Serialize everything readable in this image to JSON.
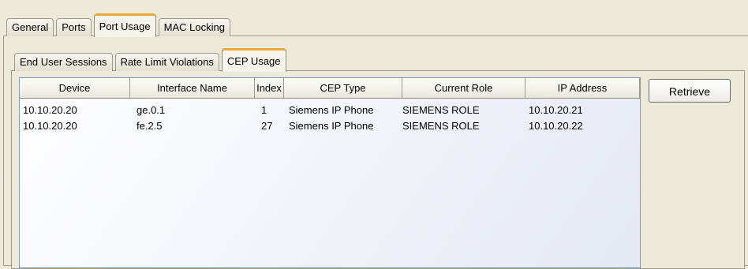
{
  "tabs": {
    "outer": [
      {
        "label": "General"
      },
      {
        "label": "Ports"
      },
      {
        "label": "Port Usage",
        "active": true
      },
      {
        "label": "MAC Locking"
      }
    ],
    "inner": [
      {
        "label": "End User Sessions"
      },
      {
        "label": "Rate Limit Violations"
      },
      {
        "label": "CEP Usage",
        "active": true
      }
    ]
  },
  "table": {
    "columns": [
      "Device",
      "Interface Name",
      "Index",
      "CEP Type",
      "Current Role",
      "IP Address"
    ],
    "rows": [
      [
        "10.10.20.20",
        "ge.0.1",
        "1",
        "Siemens IP Phone",
        "SIEMENS ROLE",
        "10.10.20.21"
      ],
      [
        "10.10.20.20",
        "fe.2.5",
        "27",
        "Siemens IP Phone",
        "SIEMENS ROLE",
        "10.10.20.22"
      ]
    ]
  },
  "buttons": {
    "retrieve_label": "Retrieve"
  },
  "colors": {
    "active_tab_accent": "#e9a83a",
    "panel_background": "#ece9d8",
    "grid_border": "#7f9db9"
  }
}
